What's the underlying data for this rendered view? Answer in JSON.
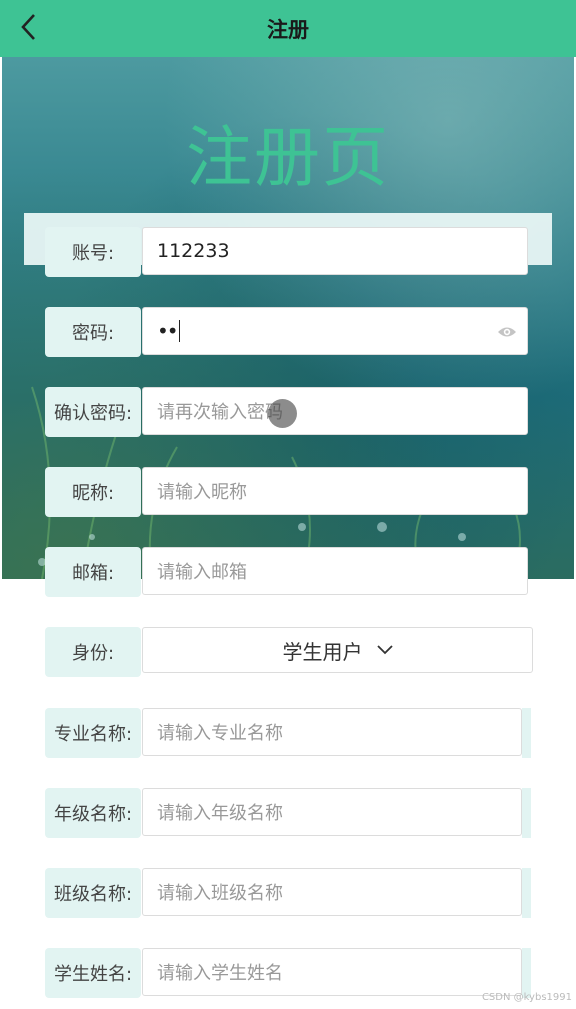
{
  "navbar": {
    "title": "注册",
    "back_icon": "chevron-left-icon"
  },
  "hero": {
    "title": "注册页"
  },
  "form": {
    "account": {
      "label": "账号:",
      "value": "112233"
    },
    "password": {
      "label": "密码:",
      "value": "••"
    },
    "confirm_password": {
      "label": "确认密码:",
      "placeholder": "请再次输入密码"
    },
    "nickname": {
      "label": "昵称:",
      "placeholder": "请输入昵称"
    },
    "email": {
      "label": "邮箱:",
      "placeholder": "请输入邮箱"
    },
    "identity": {
      "label": "身份:",
      "selected": "学生用户"
    },
    "major": {
      "label": "专业名称:",
      "placeholder": "请输入专业名称"
    },
    "grade": {
      "label": "年级名称:",
      "placeholder": "请输入年级名称"
    },
    "class_name": {
      "label": "班级名称:",
      "placeholder": "请输入班级名称"
    },
    "student_name": {
      "label": "学生姓名:",
      "placeholder": "请输入学生姓名"
    }
  },
  "watermark": "CSDN @kybs1991",
  "colors": {
    "accent": "#3ec394",
    "label_bg": "#e2f4f2"
  }
}
